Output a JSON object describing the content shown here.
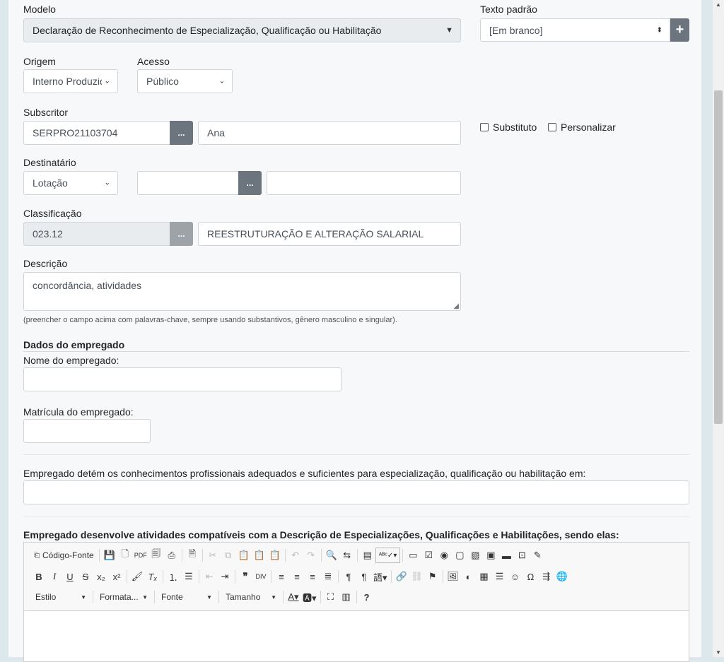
{
  "modelo": {
    "label": "Modelo",
    "value": "Declaração de Reconhecimento de Especialização, Qualificação ou Habilitação"
  },
  "texto_padrao": {
    "label": "Texto padrão",
    "value": "[Em branco]",
    "add": "+"
  },
  "origem": {
    "label": "Origem",
    "value": "Interno Produzido"
  },
  "acesso": {
    "label": "Acesso",
    "value": "Público"
  },
  "subscritor": {
    "label": "Subscritor",
    "code": "SERPRO21103704",
    "name": "Ana",
    "dots": "...",
    "substituto": "Substituto",
    "personalizar": "Personalizar"
  },
  "destinatario": {
    "label": "Destinatário",
    "tipo": "Lotação",
    "code": "",
    "name": "",
    "dots": "..."
  },
  "classificacao": {
    "label": "Classificação",
    "code": "023.12",
    "name": "REESTRUTURAÇÃO E ALTERAÇÃO SALARIAL",
    "dots": "..."
  },
  "descricao": {
    "label": "Descrição",
    "value": "concordância, atividades",
    "hint": "(preencher o campo acima com palavras-chave, sempre usando substantivos, gênero masculino e singular)."
  },
  "dados": {
    "title": "Dados do empregado",
    "nome_label": "Nome do empregado:",
    "nome": "",
    "matricula_label": "Matrícula do empregado:",
    "matricula": ""
  },
  "conhecimentos": {
    "label": "Empregado detém os conhecimentos profissionais adequados e suficientes para especialização, qualificação ou habilitação em:",
    "value": ""
  },
  "atividades": {
    "label": "Empregado desenvolve atividades compatíveis com a Descrição de Especializações, Qualificações e Habilitações, sendo elas:"
  },
  "editor": {
    "source_label": "Código-Fonte",
    "combos": {
      "estilo": "Estilo",
      "formatacao": "Formata...",
      "fonte": "Fonte",
      "tamanho": "Tamanho"
    }
  }
}
